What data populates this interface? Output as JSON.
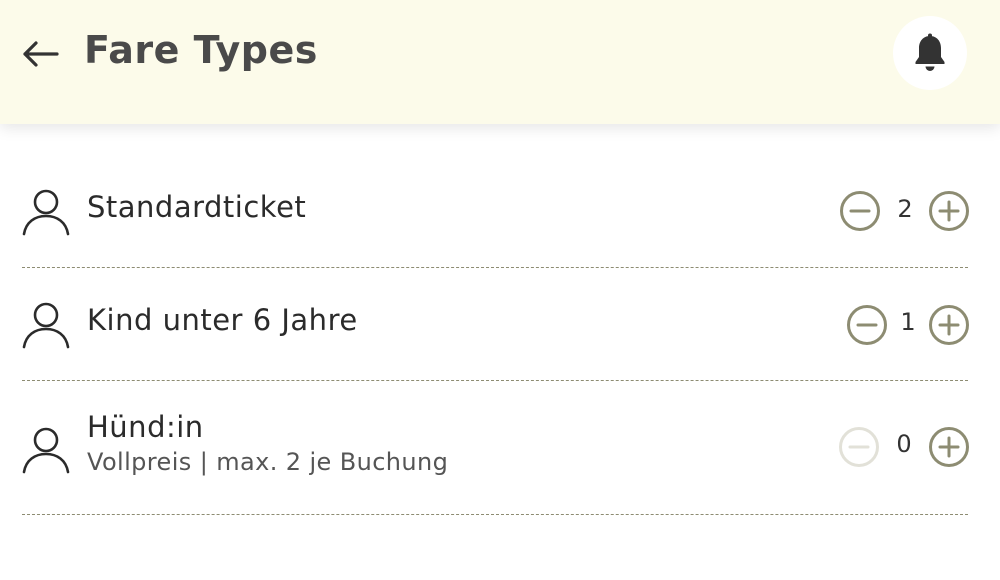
{
  "header": {
    "title": "Fare Types",
    "back_icon": "arrow-left-icon",
    "notification_icon": "bell-icon"
  },
  "colors": {
    "header_bg": "#fcfbea",
    "accent": "#8d8c72",
    "accent_disabled": "#e2e1d8",
    "text": "#2b2b2b"
  },
  "fares": [
    {
      "label": "Standardticket",
      "subtitle": "",
      "count": "2",
      "decrement_enabled": true,
      "increment_enabled": true
    },
    {
      "label": "Kind unter 6 Jahre",
      "subtitle": "",
      "count": "1",
      "decrement_enabled": true,
      "increment_enabled": true
    },
    {
      "label": "Hünd:in",
      "subtitle": "Vollpreis | max. 2 je Buchung",
      "count": "0",
      "decrement_enabled": false,
      "increment_enabled": true
    }
  ]
}
